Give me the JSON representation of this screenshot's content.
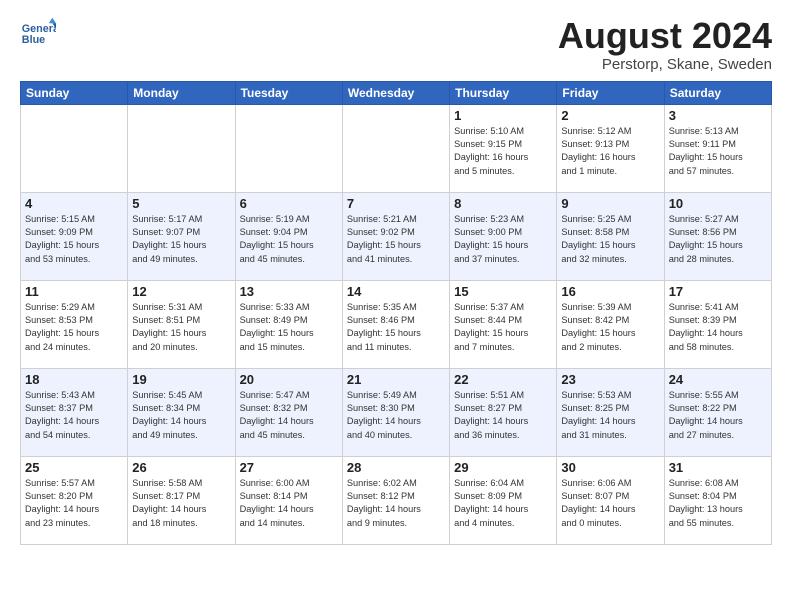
{
  "header": {
    "logo_text_general": "General",
    "logo_text_blue": "Blue",
    "month_title": "August 2024",
    "subtitle": "Perstorp, Skane, Sweden"
  },
  "days_of_week": [
    "Sunday",
    "Monday",
    "Tuesday",
    "Wednesday",
    "Thursday",
    "Friday",
    "Saturday"
  ],
  "weeks": [
    [
      {
        "day": "",
        "info": ""
      },
      {
        "day": "",
        "info": ""
      },
      {
        "day": "",
        "info": ""
      },
      {
        "day": "",
        "info": ""
      },
      {
        "day": "1",
        "info": "Sunrise: 5:10 AM\nSunset: 9:15 PM\nDaylight: 16 hours\nand 5 minutes."
      },
      {
        "day": "2",
        "info": "Sunrise: 5:12 AM\nSunset: 9:13 PM\nDaylight: 16 hours\nand 1 minute."
      },
      {
        "day": "3",
        "info": "Sunrise: 5:13 AM\nSunset: 9:11 PM\nDaylight: 15 hours\nand 57 minutes."
      }
    ],
    [
      {
        "day": "4",
        "info": "Sunrise: 5:15 AM\nSunset: 9:09 PM\nDaylight: 15 hours\nand 53 minutes."
      },
      {
        "day": "5",
        "info": "Sunrise: 5:17 AM\nSunset: 9:07 PM\nDaylight: 15 hours\nand 49 minutes."
      },
      {
        "day": "6",
        "info": "Sunrise: 5:19 AM\nSunset: 9:04 PM\nDaylight: 15 hours\nand 45 minutes."
      },
      {
        "day": "7",
        "info": "Sunrise: 5:21 AM\nSunset: 9:02 PM\nDaylight: 15 hours\nand 41 minutes."
      },
      {
        "day": "8",
        "info": "Sunrise: 5:23 AM\nSunset: 9:00 PM\nDaylight: 15 hours\nand 37 minutes."
      },
      {
        "day": "9",
        "info": "Sunrise: 5:25 AM\nSunset: 8:58 PM\nDaylight: 15 hours\nand 32 minutes."
      },
      {
        "day": "10",
        "info": "Sunrise: 5:27 AM\nSunset: 8:56 PM\nDaylight: 15 hours\nand 28 minutes."
      }
    ],
    [
      {
        "day": "11",
        "info": "Sunrise: 5:29 AM\nSunset: 8:53 PM\nDaylight: 15 hours\nand 24 minutes."
      },
      {
        "day": "12",
        "info": "Sunrise: 5:31 AM\nSunset: 8:51 PM\nDaylight: 15 hours\nand 20 minutes."
      },
      {
        "day": "13",
        "info": "Sunrise: 5:33 AM\nSunset: 8:49 PM\nDaylight: 15 hours\nand 15 minutes."
      },
      {
        "day": "14",
        "info": "Sunrise: 5:35 AM\nSunset: 8:46 PM\nDaylight: 15 hours\nand 11 minutes."
      },
      {
        "day": "15",
        "info": "Sunrise: 5:37 AM\nSunset: 8:44 PM\nDaylight: 15 hours\nand 7 minutes."
      },
      {
        "day": "16",
        "info": "Sunrise: 5:39 AM\nSunset: 8:42 PM\nDaylight: 15 hours\nand 2 minutes."
      },
      {
        "day": "17",
        "info": "Sunrise: 5:41 AM\nSunset: 8:39 PM\nDaylight: 14 hours\nand 58 minutes."
      }
    ],
    [
      {
        "day": "18",
        "info": "Sunrise: 5:43 AM\nSunset: 8:37 PM\nDaylight: 14 hours\nand 54 minutes."
      },
      {
        "day": "19",
        "info": "Sunrise: 5:45 AM\nSunset: 8:34 PM\nDaylight: 14 hours\nand 49 minutes."
      },
      {
        "day": "20",
        "info": "Sunrise: 5:47 AM\nSunset: 8:32 PM\nDaylight: 14 hours\nand 45 minutes."
      },
      {
        "day": "21",
        "info": "Sunrise: 5:49 AM\nSunset: 8:30 PM\nDaylight: 14 hours\nand 40 minutes."
      },
      {
        "day": "22",
        "info": "Sunrise: 5:51 AM\nSunset: 8:27 PM\nDaylight: 14 hours\nand 36 minutes."
      },
      {
        "day": "23",
        "info": "Sunrise: 5:53 AM\nSunset: 8:25 PM\nDaylight: 14 hours\nand 31 minutes."
      },
      {
        "day": "24",
        "info": "Sunrise: 5:55 AM\nSunset: 8:22 PM\nDaylight: 14 hours\nand 27 minutes."
      }
    ],
    [
      {
        "day": "25",
        "info": "Sunrise: 5:57 AM\nSunset: 8:20 PM\nDaylight: 14 hours\nand 23 minutes."
      },
      {
        "day": "26",
        "info": "Sunrise: 5:58 AM\nSunset: 8:17 PM\nDaylight: 14 hours\nand 18 minutes."
      },
      {
        "day": "27",
        "info": "Sunrise: 6:00 AM\nSunset: 8:14 PM\nDaylight: 14 hours\nand 14 minutes."
      },
      {
        "day": "28",
        "info": "Sunrise: 6:02 AM\nSunset: 8:12 PM\nDaylight: 14 hours\nand 9 minutes."
      },
      {
        "day": "29",
        "info": "Sunrise: 6:04 AM\nSunset: 8:09 PM\nDaylight: 14 hours\nand 4 minutes."
      },
      {
        "day": "30",
        "info": "Sunrise: 6:06 AM\nSunset: 8:07 PM\nDaylight: 14 hours\nand 0 minutes."
      },
      {
        "day": "31",
        "info": "Sunrise: 6:08 AM\nSunset: 8:04 PM\nDaylight: 13 hours\nand 55 minutes."
      }
    ]
  ]
}
